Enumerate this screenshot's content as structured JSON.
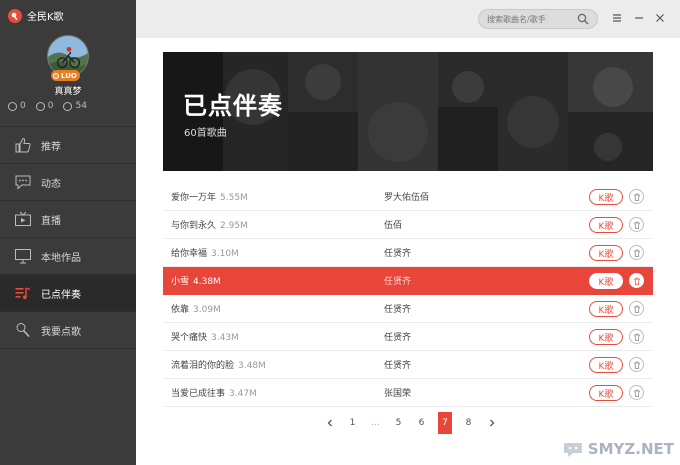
{
  "app": {
    "name": "全民K歌"
  },
  "profile": {
    "username": "真真梦",
    "level": "LUO",
    "stats": [
      {
        "icon": "coin-icon",
        "value": "0"
      },
      {
        "icon": "gift-icon",
        "value": "0"
      },
      {
        "icon": "flower-icon",
        "value": "54"
      }
    ]
  },
  "nav": [
    {
      "label": "推荐",
      "icon": "thumbs-up-icon"
    },
    {
      "label": "动态",
      "icon": "chat-bubble-icon"
    },
    {
      "label": "直播",
      "icon": "tv-icon"
    },
    {
      "label": "本地作品",
      "icon": "monitor-icon"
    },
    {
      "label": "已点伴奏",
      "icon": "music-list-icon",
      "active": true
    },
    {
      "label": "我要点歌",
      "icon": "microphone-icon"
    }
  ],
  "search": {
    "placeholder": "搜索歌曲名/歌手"
  },
  "banner": {
    "title": "已点伴奏",
    "subtitle": "60首歌曲"
  },
  "songs": [
    {
      "title": "爱你一万年",
      "size": "5.55M",
      "artist": "罗大佑伍佰",
      "action": "K歌"
    },
    {
      "title": "与你到永久",
      "size": "2.95M",
      "artist": "伍佰",
      "action": "K歌"
    },
    {
      "title": "给你幸福",
      "size": "3.10M",
      "artist": "任贤齐",
      "action": "K歌"
    },
    {
      "title": "小雪",
      "size": "4.38M",
      "artist": "任贤齐",
      "action": "K歌",
      "active": true
    },
    {
      "title": "依靠",
      "size": "3.09M",
      "artist": "任贤齐",
      "action": "K歌"
    },
    {
      "title": "哭个痛快",
      "size": "3.43M",
      "artist": "任贤齐",
      "action": "K歌"
    },
    {
      "title": "流着泪的你的脸",
      "size": "3.48M",
      "artist": "任贤齐",
      "action": "K歌"
    },
    {
      "title": "当爱已成往事",
      "size": "3.47M",
      "artist": "张国荣",
      "action": "K歌"
    }
  ],
  "pagination": {
    "pages": [
      "1",
      "...",
      "5",
      "6",
      "7",
      "8"
    ],
    "current": "7"
  },
  "watermark": {
    "text": "SMYZ.NET"
  },
  "colors": {
    "accent": "#e8463a",
    "sidebar": "#3b3b3b",
    "header": "#ececec"
  }
}
